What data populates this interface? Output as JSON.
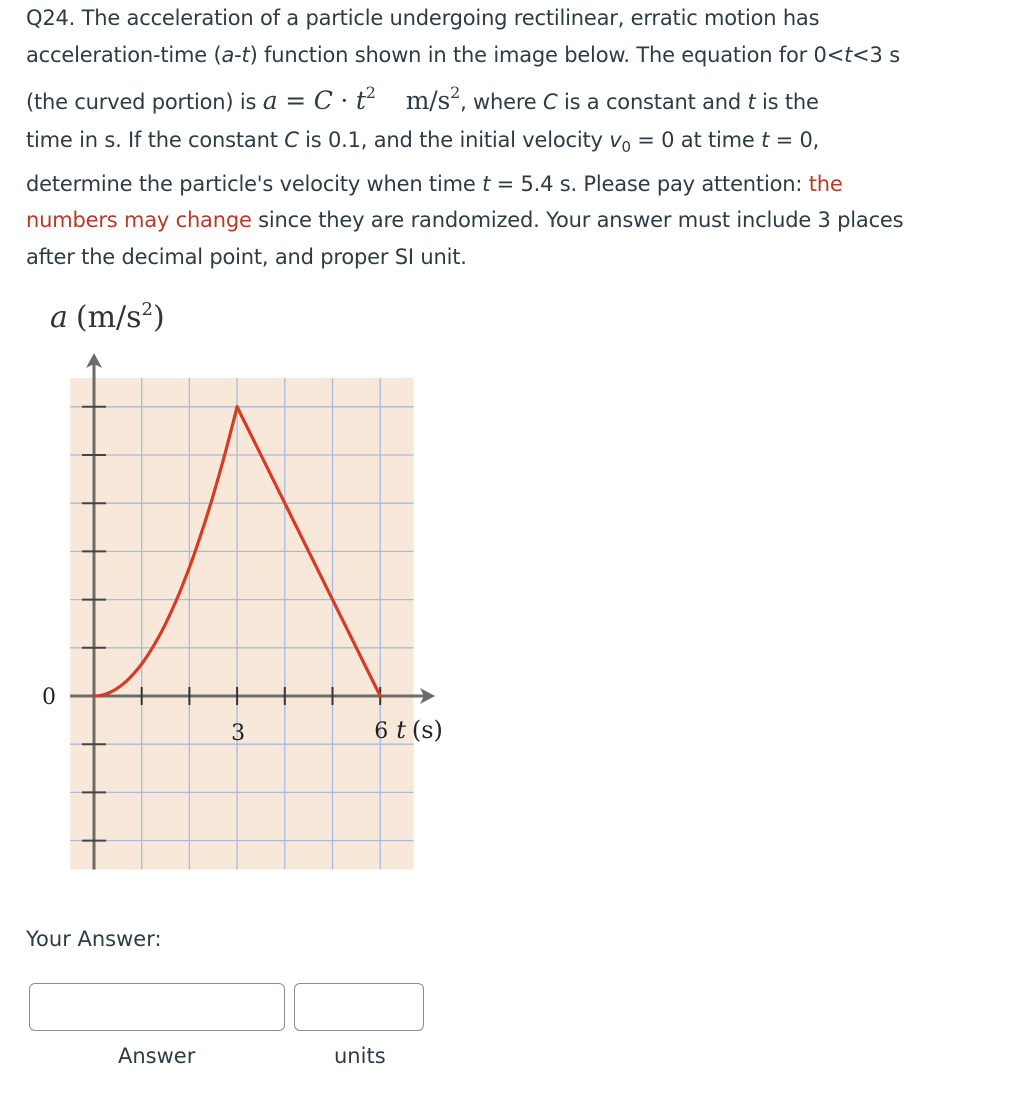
{
  "question": {
    "number": "Q24.",
    "line1": " The acceleration of a particle undergoing rectilinear, erratic motion has",
    "line2_a": "acceleration-time (",
    "line2_a_var": "a",
    "line2_dash": "-",
    "line2_t_var": "t",
    "line2_b": ") function shown in the image below. The equation for 0<",
    "line2_t2": "t",
    "line2_c": "<3 s",
    "line3_a": "(the curved portion) is ",
    "eq_a": "a",
    "eq_equals": " = ",
    "eq_C": "C",
    "eq_dot": " · ",
    "eq_t": "t",
    "eq_exp": "2",
    "eq_unit": "m/s",
    "eq_unit_exp": "2",
    "line3_b": ", where ",
    "line3_C": "C",
    "line3_c": " is a constant and ",
    "line3_t": "t",
    "line3_d": " is the",
    "line4_a": "time in s. If the constant ",
    "line4_C": "C",
    "line4_b": " is 0.1, and the initial velocity ",
    "line4_v": "v",
    "line4_v_sub": "0",
    "line4_c": " = 0 at time ",
    "line4_t": "t",
    "line4_d": " = 0,",
    "line5_a": "determine the particle's velocity when time ",
    "line5_t": "t",
    "line5_b": " = 5.4 s. Please pay attention: ",
    "line5_red": "the",
    "line6_red": "numbers may change",
    "line6_b": " since they are randomized. Your answer must include 3 places",
    "line7": "after the decimal point, and proper SI unit."
  },
  "colors": {
    "text": "#2d3b45",
    "highlight_red": "#b83a26",
    "curve_red": "#d63b26",
    "grid_bg": "#f7e8da",
    "grid_line": "#a9bbdc",
    "axis": "#6b6b6b"
  },
  "chart_data": {
    "type": "line",
    "title": "",
    "ylabel_var": "a",
    "ylabel_unit": "(m/s",
    "ylabel_exp": "2",
    "ylabel_close": ")",
    "xlabel_var": "t",
    "xlabel_unit": "(s)",
    "x_tick_labels": [
      {
        "t": 3,
        "label": "3"
      },
      {
        "t": 6,
        "label": "6"
      }
    ],
    "y_zero_label": "0",
    "x_range": [
      -0.5,
      6.7
    ],
    "y_range_grid_units": [
      -3.6,
      6.6
    ],
    "x_ticks": [
      1,
      2,
      3,
      4,
      5,
      6
    ],
    "y_ticks_grid_units": [
      -3,
      -2,
      -1,
      1,
      2,
      3,
      4,
      5,
      6
    ],
    "grid": true,
    "segments": [
      {
        "name": "curved-portion",
        "kind": "parabola",
        "t_start": 0,
        "t_end": 3,
        "a_start": 0,
        "a_end": 6
      },
      {
        "name": "linear-portion",
        "kind": "line",
        "t_start": 3,
        "t_end": 6,
        "a_start": 6,
        "a_end": 0
      }
    ],
    "note": "y values in grid divisions (schematic, unlabeled); peak at t = 3 s, returns to zero at t = 6 s"
  },
  "answer": {
    "heading": "Your Answer:",
    "answer_value": "",
    "answer_caption": "Answer",
    "units_value": "",
    "units_caption": "units"
  }
}
